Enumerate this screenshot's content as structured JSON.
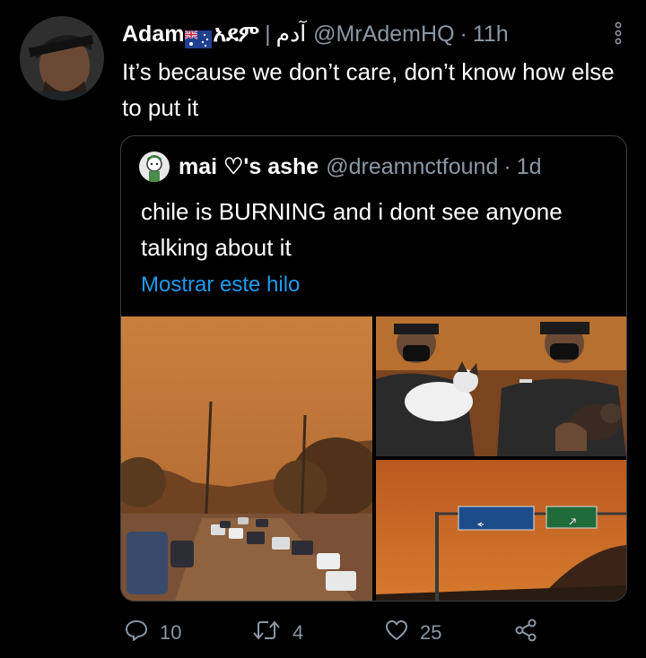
{
  "tweet": {
    "author_name": "Adam",
    "author_name_ext": "አደም",
    "author_name_sep": "|",
    "author_name_ar": "آدم",
    "handle": "@MrAdemHQ",
    "time": "11h",
    "text": "It’s because we don’t care, don’t know how else to put it",
    "flag_icon": "australia-flag-icon"
  },
  "quote": {
    "author_name": "mai ♡'s ashe",
    "handle": "@dreamnctfound",
    "time": "1d",
    "text": "chile is BURNING and i dont see anyone talking about it",
    "thread_link": "Mostrar este hilo",
    "photos": [
      {
        "signs": []
      },
      {
        "signs": []
      },
      {
        "signs": []
      },
      {
        "signs": [
          "Limache · S. Inés\nVilla Alemana",
          "Viña Villa Dulce"
        ]
      }
    ]
  },
  "actions": {
    "reply_count": "10",
    "retweet_count": "4",
    "like_count": "25"
  },
  "colors": {
    "background": "#000000",
    "secondary_text": "#8b98a5",
    "link": "#1d9bf0",
    "border": "#3a4046"
  }
}
